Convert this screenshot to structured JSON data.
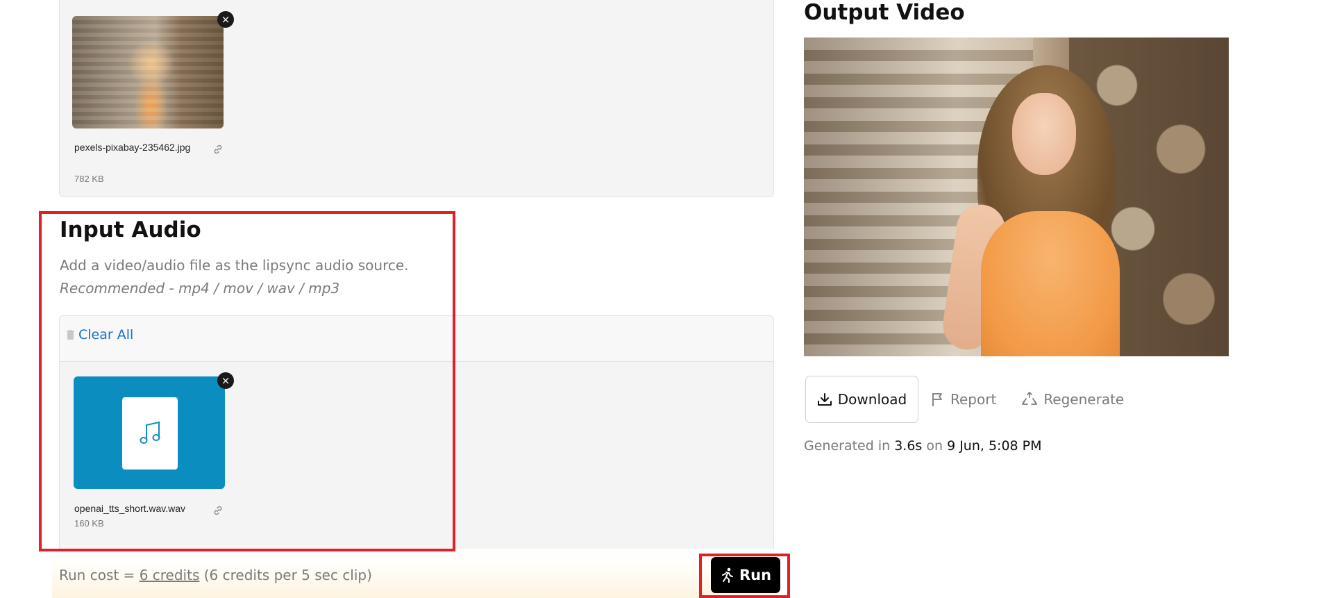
{
  "input_image": {
    "file_name": "pexels-pixabay-235462.jpg",
    "file_size": "782 KB",
    "remove_symbol": "×"
  },
  "input_audio": {
    "title": "Input Audio",
    "description": "Add a video/audio file as the lipsync audio source.",
    "recommended": "Recommended - mp4 / mov / wav / mp3",
    "clear_all_label": "Clear All",
    "file_name": "openai_tts_short.wav.wav",
    "file_size": "160 KB",
    "remove_symbol": "×"
  },
  "run": {
    "cost_prefix": "Run cost = ",
    "cost_link": "6 credits",
    "cost_suffix": " (6 credits per 5 sec clip)",
    "button_label": "Run"
  },
  "output": {
    "title": "Output Video",
    "download_label": "Download",
    "report_label": "Report",
    "regenerate_label": "Regenerate",
    "generated_prefix": "Generated in ",
    "duration": "3.6s",
    "on_word": " on ",
    "timestamp": "9 Jun, 5:08 PM"
  },
  "colors": {
    "highlight": "#e01f26",
    "link": "#1a6fd1",
    "audio_tile": "#0b8ebf",
    "run_button": "#000000"
  },
  "icons": {
    "remove": "close-icon",
    "link": "link-icon",
    "trash": "trash-icon",
    "music": "music-note-icon",
    "run": "running-person-icon",
    "download": "download-icon",
    "report": "flag-icon",
    "regenerate": "recycle-icon"
  }
}
